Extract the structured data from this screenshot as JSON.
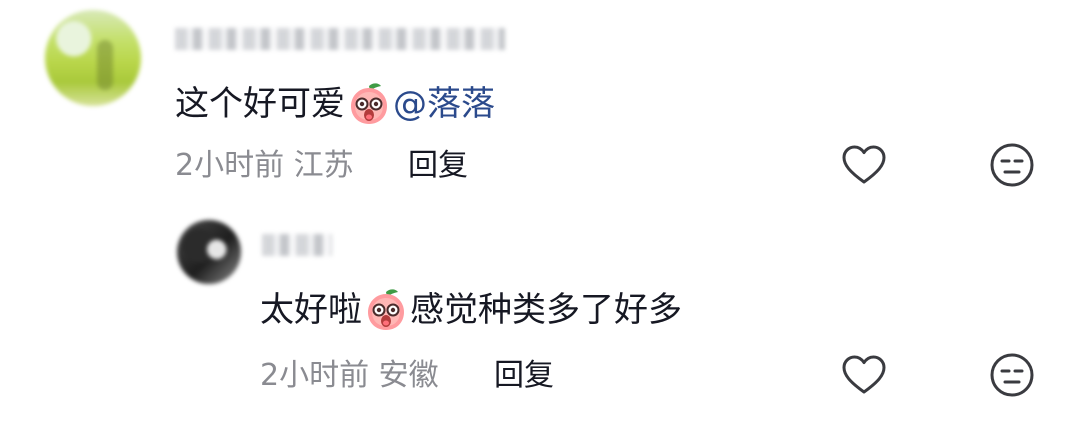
{
  "comments": {
    "main": {
      "text": "这个好可爱",
      "mention": "@落落",
      "time": "2小时前",
      "location": "江苏",
      "reply_label": "回复",
      "emoji": "peach-face-emoji",
      "like_icon": "heart-icon",
      "dislike_icon": "meh-face-icon"
    },
    "reply": {
      "text_before": "太好啦",
      "text_after": "感觉种类多了好多",
      "time": "2小时前",
      "location": "安徽",
      "reply_label": "回复",
      "emoji": "peach-face-emoji",
      "like_icon": "heart-icon",
      "dislike_icon": "meh-face-icon"
    }
  },
  "colors": {
    "mention": "#2b4a8c",
    "meta": "#8a8b91",
    "text": "#161823"
  }
}
